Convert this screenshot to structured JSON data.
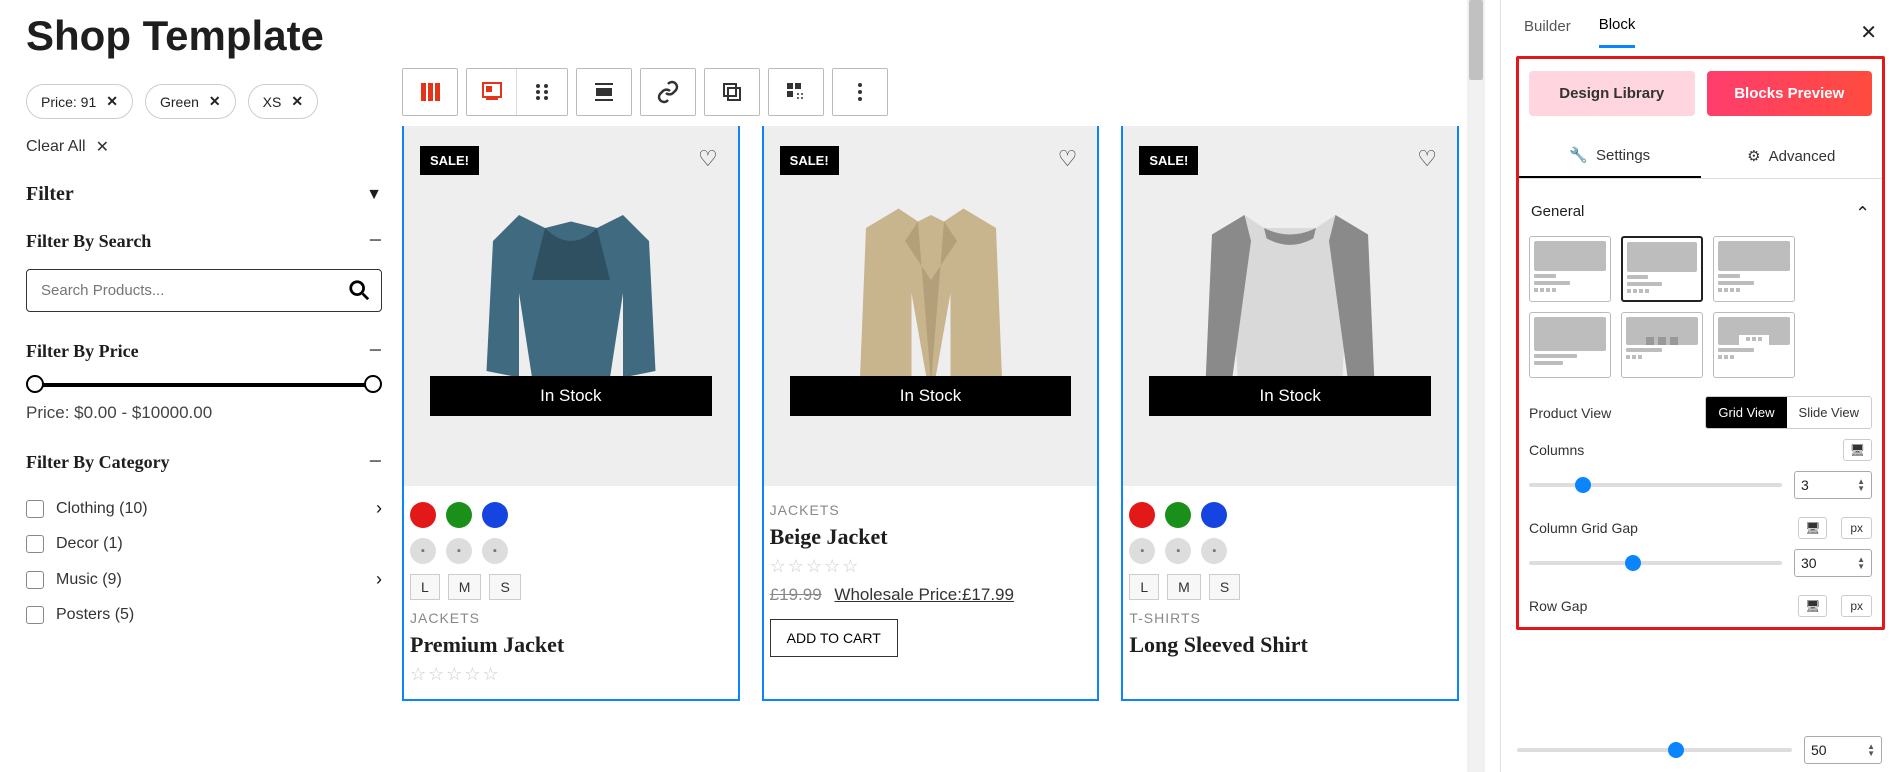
{
  "page": {
    "title": "Shop Template"
  },
  "chips": [
    {
      "label": "Price: 91"
    },
    {
      "label": "Green"
    },
    {
      "label": "XS"
    }
  ],
  "clear_all": "Clear All",
  "filter_heading": "Filter",
  "filter_search": {
    "title": "Filter By Search",
    "placeholder": "Search Products..."
  },
  "filter_price": {
    "title": "Filter By Price",
    "display": "Price: $0.00 - $10000.00"
  },
  "filter_category": {
    "title": "Filter By Category",
    "items": [
      {
        "label": "Clothing (10)",
        "has_children": true
      },
      {
        "label": "Decor (1)",
        "has_children": false
      },
      {
        "label": "Music (9)",
        "has_children": true
      },
      {
        "label": "Posters (5)",
        "has_children": false
      }
    ]
  },
  "products": [
    {
      "sale": "SALE!",
      "stock": "In Stock",
      "category": "JACKETS",
      "title": "Premium Jacket",
      "swatches": [
        "red",
        "green",
        "blue"
      ],
      "sizes": [
        "L",
        "M",
        "S"
      ],
      "has_thumbs": true
    },
    {
      "sale": "SALE!",
      "stock": "In Stock",
      "category": "JACKETS",
      "title": "Beige Jacket",
      "price_old": "£19.99",
      "price_new_label": "Wholesale Price:£17.99",
      "add_to_cart": "ADD TO CART"
    },
    {
      "sale": "SALE!",
      "stock": "In Stock",
      "category": "T-SHIRTS",
      "title": "Long Sleeved Shirt",
      "swatches": [
        "red",
        "green",
        "blue"
      ],
      "sizes": [
        "L",
        "M",
        "S"
      ],
      "has_thumbs": true
    }
  ],
  "panel": {
    "tabs": {
      "builder": "Builder",
      "block": "Block"
    },
    "design_library": "Design Library",
    "blocks_preview": "Blocks Preview",
    "settings_tab": "Settings",
    "advanced_tab": "Advanced",
    "general": "General",
    "product_view_label": "Product View",
    "grid_view": "Grid View",
    "slide_view": "Slide View",
    "columns_label": "Columns",
    "columns_value": "3",
    "col_gap_label": "Column Grid Gap",
    "col_gap_unit": "px",
    "col_gap_value": "30",
    "row_gap_label": "Row Gap",
    "row_gap_unit": "px",
    "row_gap_value": "50"
  }
}
